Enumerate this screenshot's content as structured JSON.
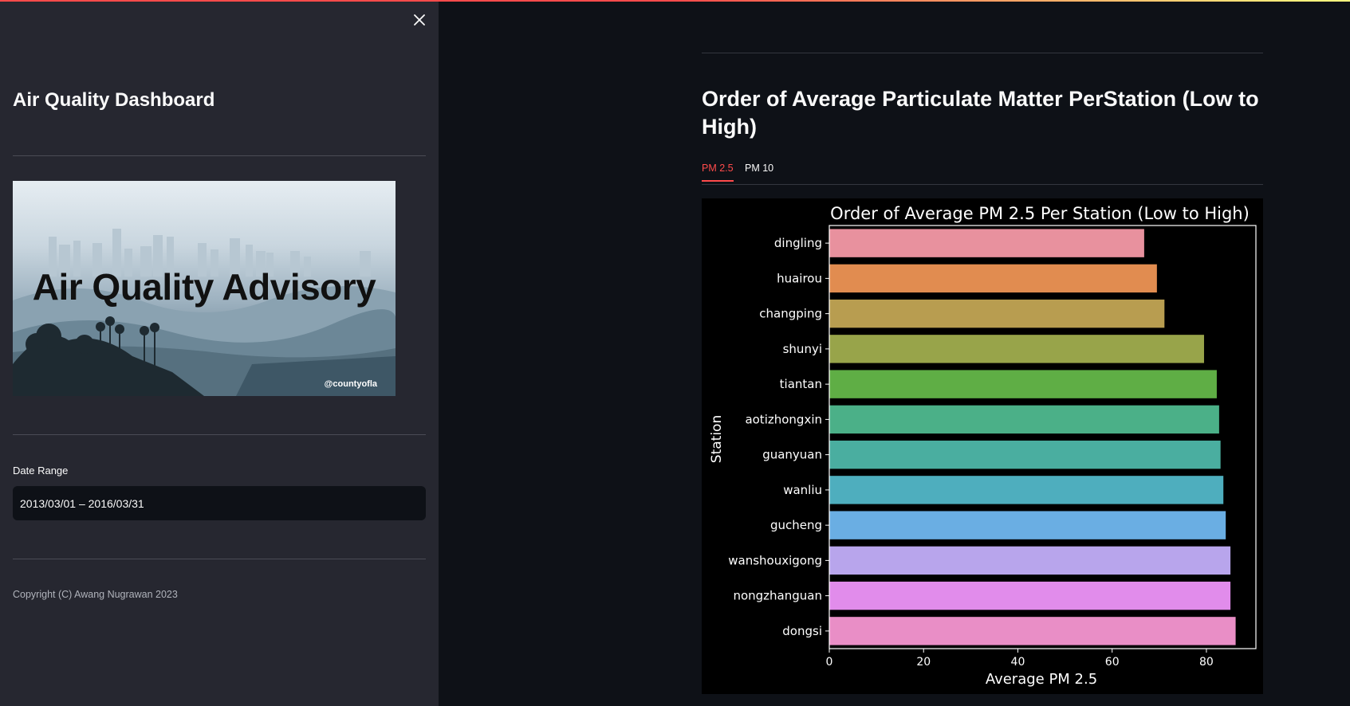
{
  "sidebar": {
    "title": "Air Quality Dashboard",
    "banner": {
      "text": "Air Quality Advisory",
      "credit": "@countyofla"
    },
    "date_range": {
      "label": "Date Range",
      "value": "2013/03/01 – 2016/03/31"
    },
    "copyright": "Copyright (C) Awang Nugrawan 2023",
    "close_icon": "close-icon"
  },
  "main": {
    "title": "Order of Average Particulate Matter PerStation (Low to High)",
    "tabs": [
      {
        "label": "PM 2.5",
        "active": true
      },
      {
        "label": "PM 10",
        "active": false
      }
    ]
  },
  "colors": {
    "accent": "#ff4b4b",
    "sidebar_bg": "#262730",
    "main_bg": "#0e1117"
  },
  "chart_data": {
    "type": "bar",
    "orientation": "horizontal",
    "title": "Order of Average PM 2.5 Per Station (Low to High)",
    "xlabel": "Average PM 2.5",
    "ylabel": "Station",
    "xlim": [
      0,
      90.5
    ],
    "xticks": [
      0,
      20,
      40,
      60,
      80
    ],
    "grid": false,
    "categories": [
      "dingling",
      "huairou",
      "changping",
      "shunyi",
      "tiantan",
      "aotizhongxin",
      "guanyuan",
      "wanliu",
      "gucheng",
      "wanshouxigong",
      "nongzhanguan",
      "dongsi"
    ],
    "values": [
      66.8,
      69.5,
      71.1,
      79.5,
      82.2,
      82.7,
      83.0,
      83.6,
      84.1,
      85.1,
      85.1,
      86.2
    ],
    "colors": [
      "#e8919e",
      "#e18c50",
      "#b89d50",
      "#98a44a",
      "#5fae45",
      "#4bb088",
      "#4aaea0",
      "#4eaebe",
      "#6aaee3",
      "#b8a5ec",
      "#e18ceb",
      "#e98ec6"
    ]
  }
}
